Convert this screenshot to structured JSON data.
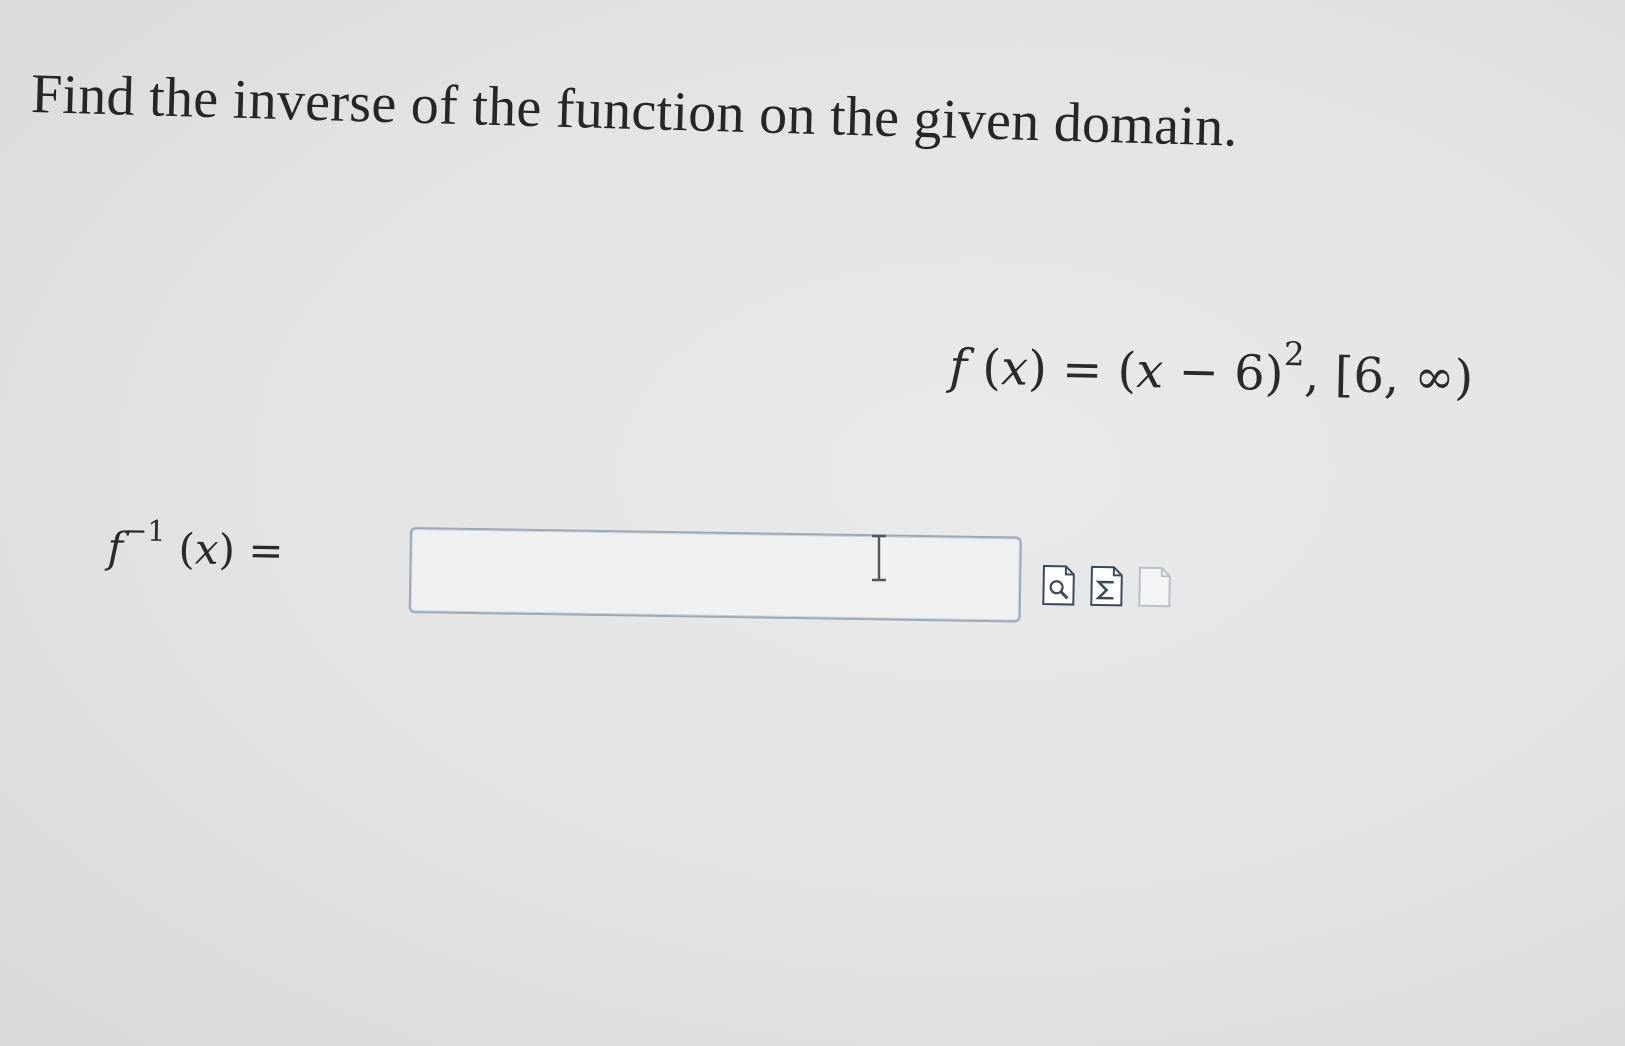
{
  "question": {
    "prompt": "Find the inverse of the function on the given domain."
  },
  "given": {
    "func_name": "f",
    "var": "x",
    "equals": "=",
    "open_paren": "(",
    "minus": "−",
    "constant": "6",
    "close_paren": ")",
    "exponent": "2",
    "comma": ",",
    "domain": "[6, ∞)"
  },
  "answer": {
    "label_func": "f",
    "label_exp": "−1",
    "label_var": "x",
    "label_equals": "=",
    "input_value": ""
  },
  "toolbar": {
    "icons": [
      "preview-icon",
      "equation-editor-icon",
      "blank-page-icon"
    ]
  }
}
